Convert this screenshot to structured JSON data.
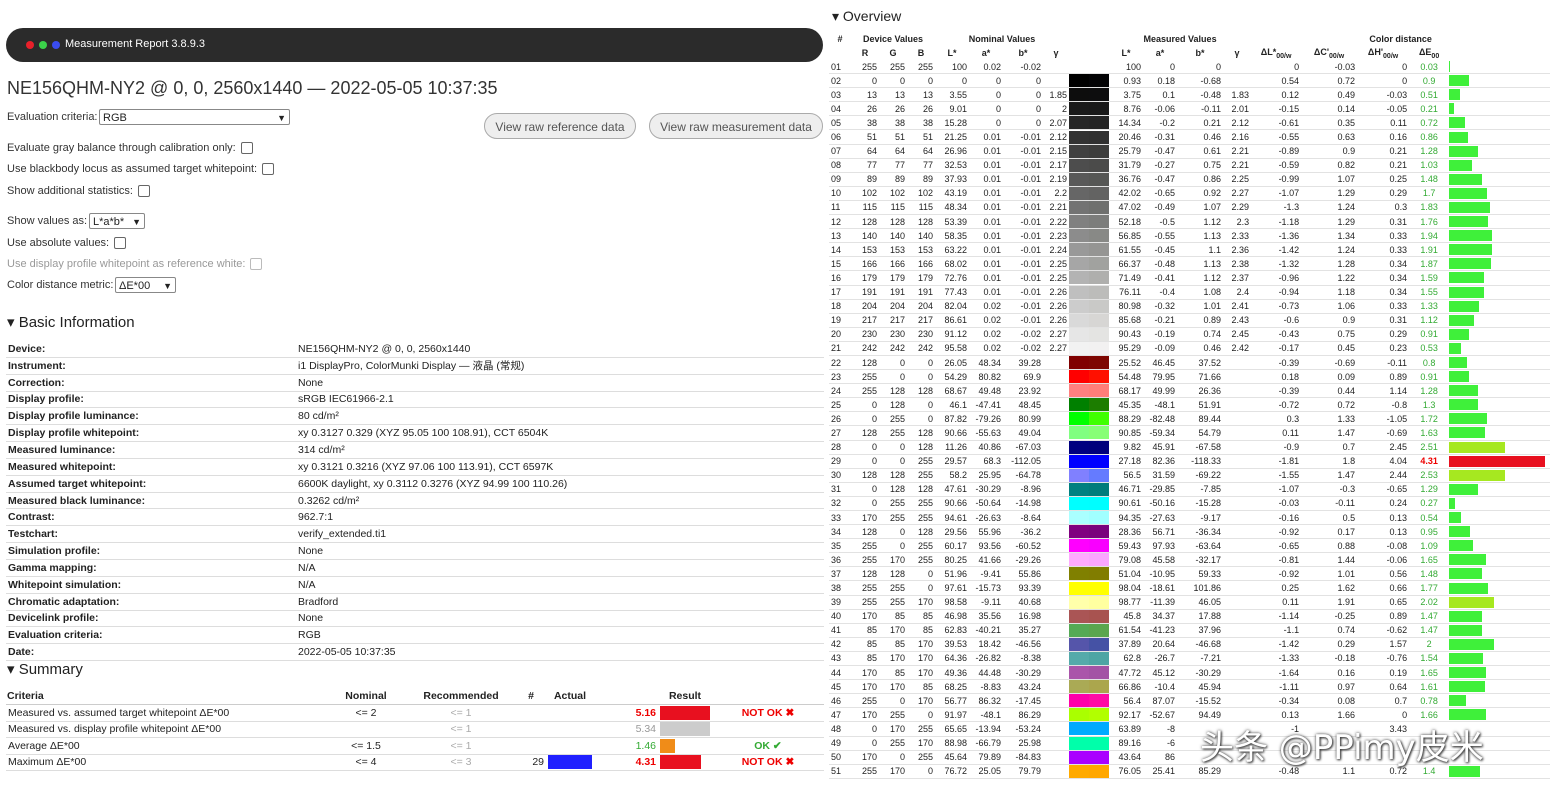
{
  "window": {
    "title": "Measurement Report 3.8.9.3"
  },
  "heading": "NE156QHM-NY2 @ 0, 0, 2560x1440 — 2022-05-05 10:37:35",
  "controls": {
    "eval_label": "Evaluation criteria:",
    "eval_value": "RGB",
    "view_ref_label": "View raw reference data",
    "view_meas_label": "View raw measurement data",
    "gray_label": "Evaluate gray balance through calibration only:",
    "blackbody_label": "Use blackbody locus as assumed target whitepoint:",
    "addstats_label": "Show additional statistics:",
    "showvals_label": "Show values as:",
    "showvals_value": "L*a*b*",
    "absvals_label": "Use absolute values:",
    "profwp_label": "Use display profile whitepoint as reference white:",
    "metric_label": "Color distance metric:",
    "metric_value": "ΔE*00"
  },
  "basic": {
    "title": "Basic Information",
    "rows": [
      [
        "Device:",
        "NE156QHM-NY2 @ 0, 0, 2560x1440"
      ],
      [
        "Instrument:",
        "i1 DisplayPro, ColorMunki Display — 液晶 (常规)"
      ],
      [
        "Correction:",
        "None"
      ],
      [
        "Display profile:",
        "sRGB IEC61966-2.1"
      ],
      [
        "Display profile luminance:",
        "80 cd/m²"
      ],
      [
        "Display profile whitepoint:",
        "xy 0.3127 0.329 (XYZ 95.05 100 108.91), CCT 6504K"
      ],
      [
        "Measured luminance:",
        "314 cd/m²"
      ],
      [
        "Measured whitepoint:",
        "xy 0.3121 0.3216 (XYZ 97.06 100 113.91), CCT 6597K"
      ],
      [
        "Assumed target whitepoint:",
        "6600K daylight, xy 0.3112 0.3276 (XYZ 94.99 100 110.26)"
      ],
      [
        "Measured black luminance:",
        "0.3262 cd/m²"
      ],
      [
        "Contrast:",
        "962.7:1"
      ],
      [
        "Testchart:",
        "verify_extended.ti1"
      ],
      [
        "Simulation profile:",
        "None"
      ],
      [
        "Gamma mapping:",
        "N/A"
      ],
      [
        "Whitepoint simulation:",
        "N/A"
      ],
      [
        "Chromatic adaptation:",
        "Bradford"
      ],
      [
        "Devicelink profile:",
        "None"
      ],
      [
        "Evaluation criteria:",
        "RGB"
      ],
      [
        "Date:",
        "2022-05-05 10:37:35"
      ]
    ]
  },
  "summary": {
    "title": "Summary",
    "headers": [
      "Criteria",
      "Nominal",
      "Recommended",
      "#",
      "Actual",
      "Result"
    ],
    "rows": [
      {
        "criteria": "Measured vs. assumed target whitepoint ΔE*00",
        "nominal": "<= 2",
        "recommended": "<= 1",
        "num": "",
        "actual": "5.16",
        "result": "NOT OK ✖",
        "status": "bad",
        "fill": 1.0,
        "color": "#e8101f",
        "patch": ""
      },
      {
        "criteria": "Measured vs. display profile whitepoint ΔE*00",
        "nominal": "",
        "recommended": "<= 1",
        "num": "",
        "actual": "5.34",
        "result": "",
        "status": "none",
        "fill": 1.0,
        "color": "#cccccc",
        "patch": ""
      },
      {
        "criteria": "Average ΔE*00",
        "nominal": "<= 1.5",
        "recommended": "<= 1",
        "num": "",
        "actual": "1.46",
        "result": "OK ✔",
        "status": "ok",
        "fill": 0.3,
        "color": "#f08c18",
        "patch": ""
      },
      {
        "criteria": "Maximum ΔE*00",
        "nominal": "<= 4",
        "recommended": "<= 3",
        "num": "29",
        "actual": "4.31",
        "result": "NOT OK ✖",
        "status": "bad",
        "fill": 0.82,
        "color": "#e8101f",
        "patch": "#2020ff"
      }
    ]
  },
  "overview": {
    "title": "Overview",
    "groups": [
      "#",
      "Device Values",
      "Nominal Values",
      "Measured Values",
      "Color distance"
    ],
    "headers": [
      "",
      "R",
      "G",
      "B",
      "L*",
      "a*",
      "b*",
      "γ",
      "",
      "L*",
      "a*",
      "b*",
      "γ",
      "ΔL*00/w",
      "ΔC'00/w",
      "ΔH'00/w",
      "ΔE00",
      ""
    ],
    "rows": [
      [
        "01",
        "255",
        "255",
        "255",
        "100",
        "0.02",
        "-0.02",
        "",
        "100",
        "0",
        "0",
        "",
        "0",
        "-0.03",
        "0",
        "0.03"
      ],
      [
        "02",
        "0",
        "0",
        "0",
        "0",
        "0",
        "0",
        "",
        "0.93",
        "0.18",
        "-0.68",
        "",
        "0.54",
        "0.72",
        "0",
        "0.9"
      ],
      [
        "03",
        "13",
        "13",
        "13",
        "3.55",
        "0",
        "0",
        "1.85",
        "3.75",
        "0.1",
        "-0.48",
        "1.83",
        "0.12",
        "0.49",
        "-0.03",
        "0.51"
      ],
      [
        "04",
        "26",
        "26",
        "26",
        "9.01",
        "0",
        "0",
        "2",
        "8.76",
        "-0.06",
        "-0.11",
        "2.01",
        "-0.15",
        "0.14",
        "-0.05",
        "0.21"
      ],
      [
        "05",
        "38",
        "38",
        "38",
        "15.28",
        "0",
        "0",
        "2.07",
        "14.34",
        "-0.2",
        "0.21",
        "2.12",
        "-0.61",
        "0.35",
        "0.11",
        "0.72"
      ],
      [
        "06",
        "51",
        "51",
        "51",
        "21.25",
        "0.01",
        "-0.01",
        "2.12",
        "20.46",
        "-0.31",
        "0.46",
        "2.16",
        "-0.55",
        "0.63",
        "0.16",
        "0.86"
      ],
      [
        "07",
        "64",
        "64",
        "64",
        "26.96",
        "0.01",
        "-0.01",
        "2.15",
        "25.79",
        "-0.47",
        "0.61",
        "2.21",
        "-0.89",
        "0.9",
        "0.21",
        "1.28"
      ],
      [
        "08",
        "77",
        "77",
        "77",
        "32.53",
        "0.01",
        "-0.01",
        "2.17",
        "31.79",
        "-0.27",
        "0.75",
        "2.21",
        "-0.59",
        "0.82",
        "0.21",
        "1.03"
      ],
      [
        "09",
        "89",
        "89",
        "89",
        "37.93",
        "0.01",
        "-0.01",
        "2.19",
        "36.76",
        "-0.47",
        "0.86",
        "2.25",
        "-0.99",
        "1.07",
        "0.25",
        "1.48"
      ],
      [
        "10",
        "102",
        "102",
        "102",
        "43.19",
        "0.01",
        "-0.01",
        "2.2",
        "42.02",
        "-0.65",
        "0.92",
        "2.27",
        "-1.07",
        "1.29",
        "0.29",
        "1.7"
      ],
      [
        "11",
        "115",
        "115",
        "115",
        "48.34",
        "0.01",
        "-0.01",
        "2.21",
        "47.02",
        "-0.49",
        "1.07",
        "2.29",
        "-1.3",
        "1.24",
        "0.3",
        "1.83"
      ],
      [
        "12",
        "128",
        "128",
        "128",
        "53.39",
        "0.01",
        "-0.01",
        "2.22",
        "52.18",
        "-0.5",
        "1.12",
        "2.3",
        "-1.18",
        "1.29",
        "0.31",
        "1.76"
      ],
      [
        "13",
        "140",
        "140",
        "140",
        "58.35",
        "0.01",
        "-0.01",
        "2.23",
        "56.85",
        "-0.55",
        "1.13",
        "2.33",
        "-1.36",
        "1.34",
        "0.33",
        "1.94"
      ],
      [
        "14",
        "153",
        "153",
        "153",
        "63.22",
        "0.01",
        "-0.01",
        "2.24",
        "61.55",
        "-0.45",
        "1.1",
        "2.36",
        "-1.42",
        "1.24",
        "0.33",
        "1.91"
      ],
      [
        "15",
        "166",
        "166",
        "166",
        "68.02",
        "0.01",
        "-0.01",
        "2.25",
        "66.37",
        "-0.48",
        "1.13",
        "2.38",
        "-1.32",
        "1.28",
        "0.34",
        "1.87"
      ],
      [
        "16",
        "179",
        "179",
        "179",
        "72.76",
        "0.01",
        "-0.01",
        "2.25",
        "71.49",
        "-0.41",
        "1.12",
        "2.37",
        "-0.96",
        "1.22",
        "0.34",
        "1.59"
      ],
      [
        "17",
        "191",
        "191",
        "191",
        "77.43",
        "0.01",
        "-0.01",
        "2.26",
        "76.11",
        "-0.4",
        "1.08",
        "2.4",
        "-0.94",
        "1.18",
        "0.34",
        "1.55"
      ],
      [
        "18",
        "204",
        "204",
        "204",
        "82.04",
        "0.02",
        "-0.01",
        "2.26",
        "80.98",
        "-0.32",
        "1.01",
        "2.41",
        "-0.73",
        "1.06",
        "0.33",
        "1.33"
      ],
      [
        "19",
        "217",
        "217",
        "217",
        "86.61",
        "0.02",
        "-0.01",
        "2.26",
        "85.68",
        "-0.21",
        "0.89",
        "2.43",
        "-0.6",
        "0.9",
        "0.31",
        "1.12"
      ],
      [
        "20",
        "230",
        "230",
        "230",
        "91.12",
        "0.02",
        "-0.02",
        "2.27",
        "90.43",
        "-0.19",
        "0.74",
        "2.45",
        "-0.43",
        "0.75",
        "0.29",
        "0.91"
      ],
      [
        "21",
        "242",
        "242",
        "242",
        "95.58",
        "0.02",
        "-0.02",
        "2.27",
        "95.29",
        "-0.09",
        "0.46",
        "2.42",
        "-0.17",
        "0.45",
        "0.23",
        "0.53"
      ],
      [
        "22",
        "128",
        "0",
        "0",
        "26.05",
        "48.34",
        "39.28",
        "",
        "25.52",
        "46.45",
        "37.52",
        "",
        "-0.39",
        "-0.69",
        "-0.11",
        "0.8"
      ],
      [
        "23",
        "255",
        "0",
        "0",
        "54.29",
        "80.82",
        "69.9",
        "",
        "54.48",
        "79.95",
        "71.66",
        "",
        "0.18",
        "0.09",
        "0.89",
        "0.91"
      ],
      [
        "24",
        "255",
        "128",
        "128",
        "68.67",
        "49.48",
        "23.92",
        "",
        "68.17",
        "49.99",
        "26.36",
        "",
        "-0.39",
        "0.44",
        "1.14",
        "1.28"
      ],
      [
        "25",
        "0",
        "128",
        "0",
        "46.1",
        "-47.41",
        "48.45",
        "",
        "45.35",
        "-48.1",
        "51.91",
        "",
        "-0.72",
        "0.72",
        "-0.8",
        "1.3"
      ],
      [
        "26",
        "0",
        "255",
        "0",
        "87.82",
        "-79.26",
        "80.99",
        "",
        "88.29",
        "-82.48",
        "89.44",
        "",
        "0.3",
        "1.33",
        "-1.05",
        "1.72"
      ],
      [
        "27",
        "128",
        "255",
        "128",
        "90.66",
        "-55.63",
        "49.04",
        "",
        "90.85",
        "-59.34",
        "54.79",
        "",
        "0.11",
        "1.47",
        "-0.69",
        "1.63"
      ],
      [
        "28",
        "0",
        "0",
        "128",
        "11.26",
        "40.86",
        "-67.03",
        "",
        "9.82",
        "45.91",
        "-67.58",
        "",
        "-0.9",
        "0.7",
        "2.45",
        "2.51"
      ],
      [
        "29",
        "0",
        "0",
        "255",
        "29.57",
        "68.3",
        "-112.05",
        "",
        "27.18",
        "82.36",
        "-118.33",
        "",
        "-1.81",
        "1.8",
        "4.04",
        "4.31"
      ],
      [
        "30",
        "128",
        "128",
        "255",
        "58.2",
        "25.95",
        "-64.78",
        "",
        "56.5",
        "31.59",
        "-69.22",
        "",
        "-1.55",
        "1.47",
        "2.44",
        "2.53"
      ],
      [
        "31",
        "0",
        "128",
        "128",
        "47.61",
        "-30.29",
        "-8.96",
        "",
        "46.71",
        "-29.85",
        "-7.85",
        "",
        "-1.07",
        "-0.3",
        "-0.65",
        "1.29"
      ],
      [
        "32",
        "0",
        "255",
        "255",
        "90.66",
        "-50.64",
        "-14.98",
        "",
        "90.61",
        "-50.16",
        "-15.28",
        "",
        "-0.03",
        "-0.11",
        "0.24",
        "0.27"
      ],
      [
        "33",
        "170",
        "255",
        "255",
        "94.61",
        "-26.63",
        "-8.64",
        "",
        "94.35",
        "-27.63",
        "-9.17",
        "",
        "-0.16",
        "0.5",
        "0.13",
        "0.54"
      ],
      [
        "34",
        "128",
        "0",
        "128",
        "29.56",
        "55.96",
        "-36.2",
        "",
        "28.36",
        "56.71",
        "-36.34",
        "",
        "-0.92",
        "0.17",
        "0.13",
        "0.95"
      ],
      [
        "35",
        "255",
        "0",
        "255",
        "60.17",
        "93.56",
        "-60.52",
        "",
        "59.43",
        "97.93",
        "-63.64",
        "",
        "-0.65",
        "0.88",
        "-0.08",
        "1.09"
      ],
      [
        "36",
        "255",
        "170",
        "255",
        "80.25",
        "41.66",
        "-29.26",
        "",
        "79.08",
        "45.58",
        "-32.17",
        "",
        "-0.81",
        "1.44",
        "-0.06",
        "1.65"
      ],
      [
        "37",
        "128",
        "128",
        "0",
        "51.96",
        "-9.41",
        "55.86",
        "",
        "51.04",
        "-10.95",
        "59.33",
        "",
        "-0.92",
        "1.01",
        "0.56",
        "1.48"
      ],
      [
        "38",
        "255",
        "255",
        "0",
        "97.61",
        "-15.73",
        "93.39",
        "",
        "98.04",
        "-18.61",
        "101.86",
        "",
        "0.25",
        "1.62",
        "0.66",
        "1.77"
      ],
      [
        "39",
        "255",
        "255",
        "170",
        "98.58",
        "-9.11",
        "40.68",
        "",
        "98.77",
        "-11.39",
        "46.05",
        "",
        "0.11",
        "1.91",
        "0.65",
        "2.02"
      ],
      [
        "40",
        "170",
        "85",
        "85",
        "46.98",
        "35.56",
        "16.98",
        "",
        "45.8",
        "34.37",
        "17.88",
        "",
        "-1.14",
        "-0.25",
        "0.89",
        "1.47"
      ],
      [
        "41",
        "85",
        "170",
        "85",
        "62.83",
        "-40.21",
        "35.27",
        "",
        "61.54",
        "-41.23",
        "37.96",
        "",
        "-1.1",
        "0.74",
        "-0.62",
        "1.47"
      ],
      [
        "42",
        "85",
        "85",
        "170",
        "39.53",
        "18.42",
        "-46.56",
        "",
        "37.89",
        "20.64",
        "-46.68",
        "",
        "-1.42",
        "0.29",
        "1.57",
        "2"
      ],
      [
        "43",
        "85",
        "170",
        "170",
        "64.36",
        "-26.82",
        "-8.38",
        "",
        "62.8",
        "-26.7",
        "-7.21",
        "",
        "-1.33",
        "-0.18",
        "-0.76",
        "1.54"
      ],
      [
        "44",
        "170",
        "85",
        "170",
        "49.36",
        "44.48",
        "-30.29",
        "",
        "47.72",
        "45.12",
        "-30.29",
        "",
        "-1.64",
        "0.16",
        "0.19",
        "1.65"
      ],
      [
        "45",
        "170",
        "170",
        "85",
        "68.25",
        "-8.83",
        "43.24",
        "",
        "66.86",
        "-10.4",
        "45.94",
        "",
        "-1.11",
        "0.97",
        "0.64",
        "1.61"
      ],
      [
        "46",
        "255",
        "0",
        "170",
        "56.77",
        "86.32",
        "-17.45",
        "",
        "56.4",
        "87.07",
        "-15.52",
        "",
        "-0.34",
        "0.08",
        "0.7",
        "0.78"
      ],
      [
        "47",
        "170",
        "255",
        "0",
        "91.97",
        "-48.1",
        "86.29",
        "",
        "92.17",
        "-52.67",
        "94.49",
        "",
        "0.13",
        "1.66",
        "0",
        "1.66"
      ],
      [
        "48",
        "0",
        "170",
        "255",
        "65.65",
        "-13.94",
        "-53.24",
        "",
        "63.89",
        "-8",
        "",
        "",
        "-1",
        "",
        "3.43",
        ""
      ],
      [
        "49",
        "0",
        "255",
        "170",
        "88.98",
        "-66.79",
        "25.98",
        "",
        "89.16",
        "-6",
        "",
        "",
        "",
        "",
        "",
        ""
      ],
      [
        "50",
        "170",
        "0",
        "255",
        "45.64",
        "79.89",
        "-84.83",
        "",
        "43.64",
        "86",
        "",
        "",
        "",
        "",
        "",
        ""
      ],
      [
        "51",
        "255",
        "170",
        "0",
        "76.72",
        "25.05",
        "79.79",
        "",
        "76.05",
        "25.41",
        "85.29",
        "",
        "-0.48",
        "1.1",
        "0.72",
        "1.4"
      ]
    ]
  },
  "watermark": "头条 @PPimy皮米"
}
